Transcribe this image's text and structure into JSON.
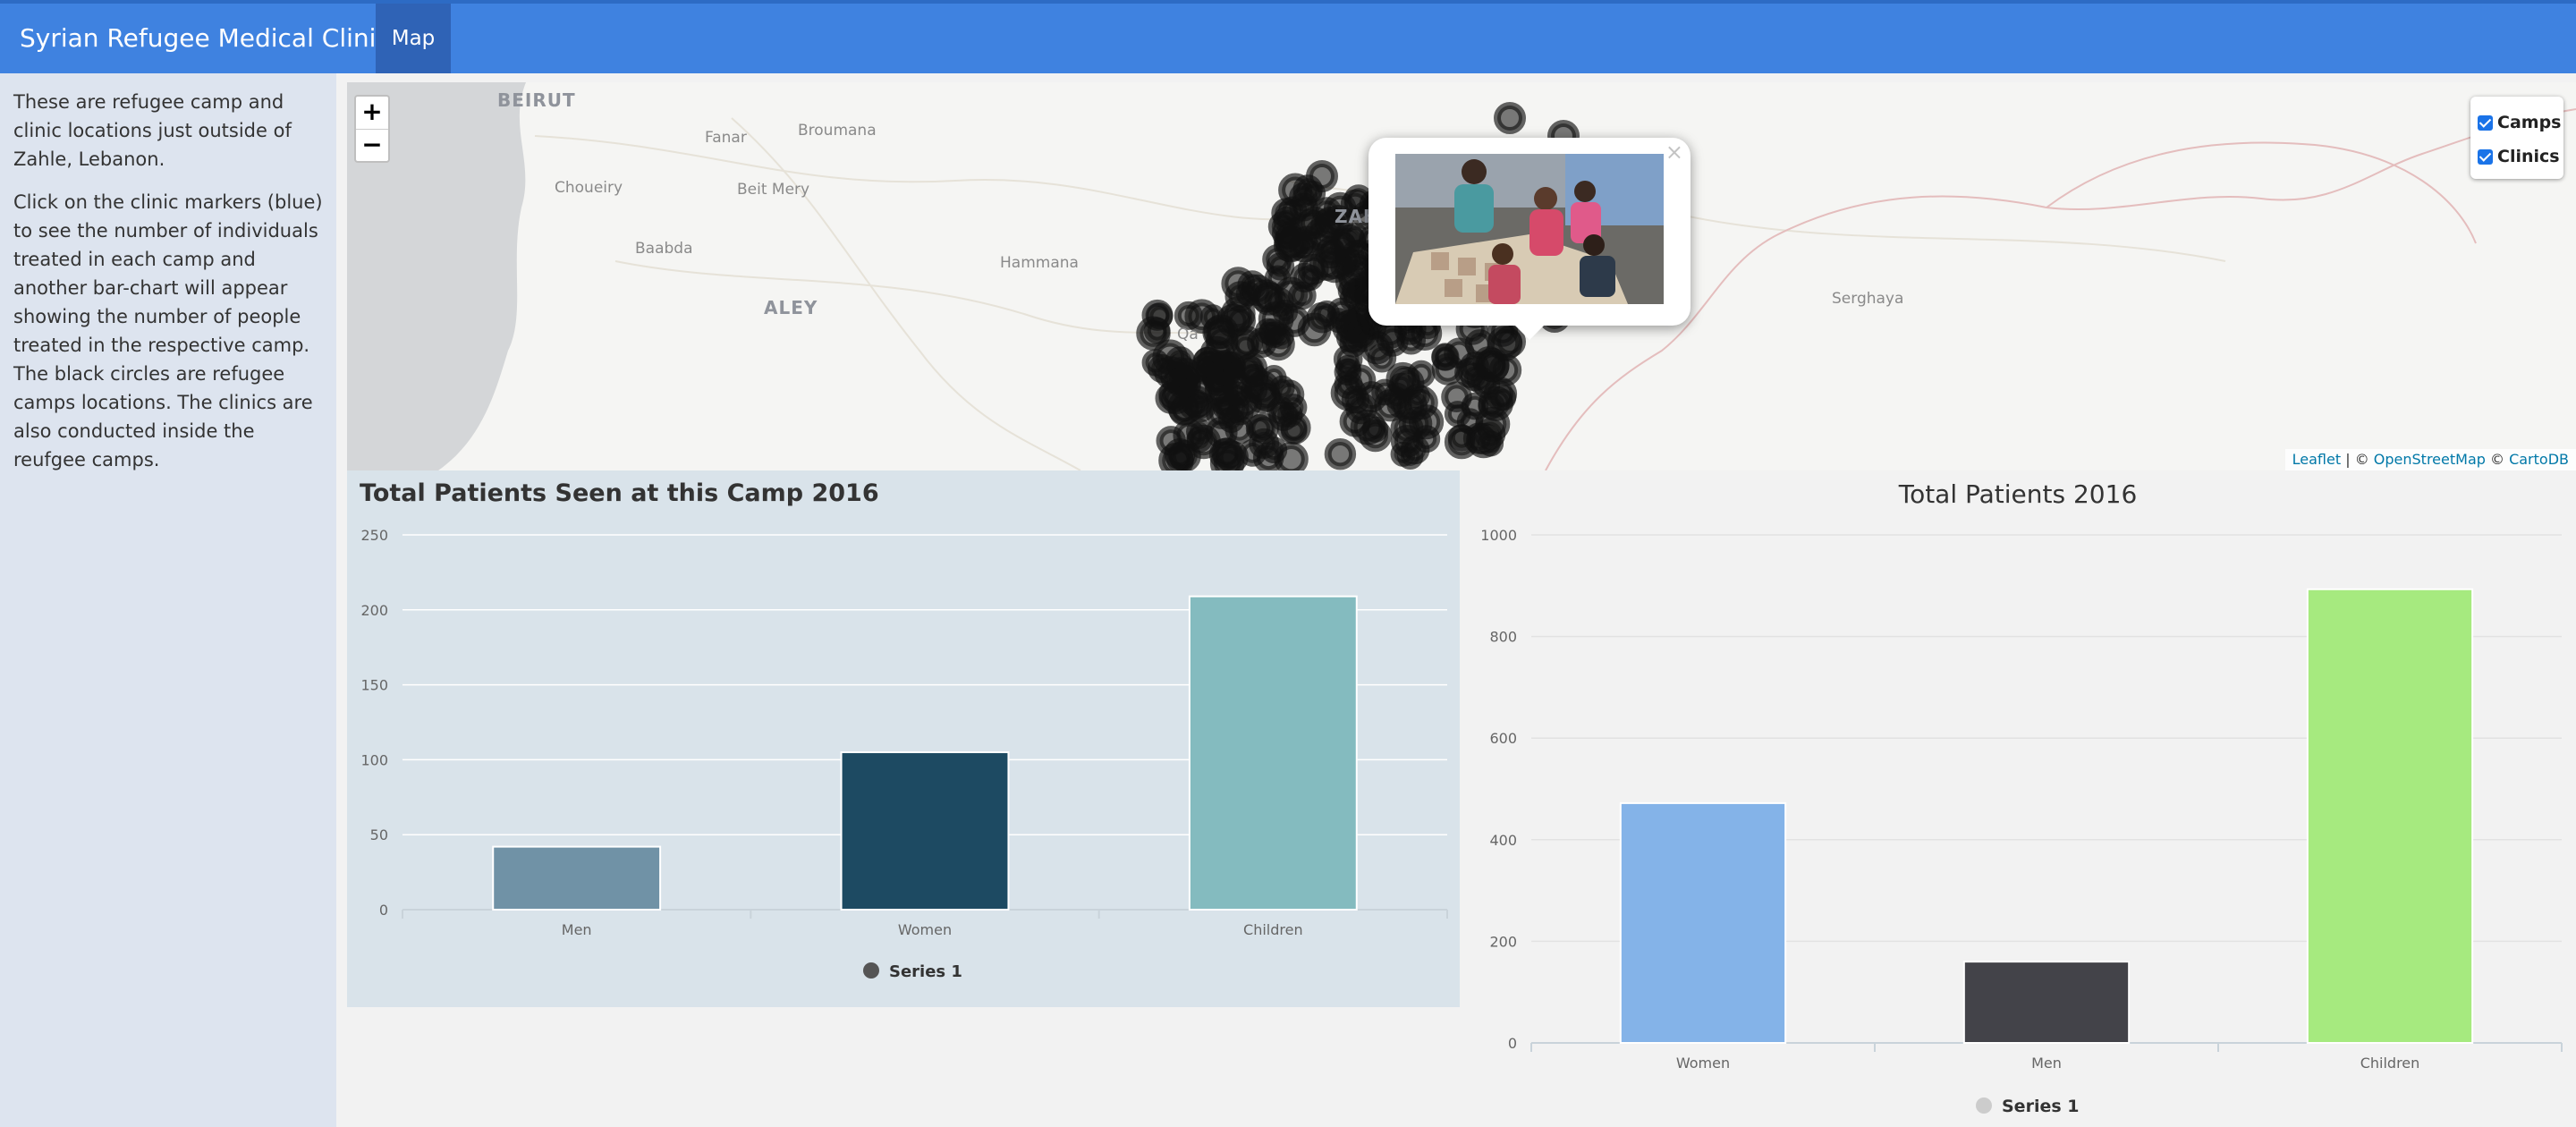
{
  "navbar": {
    "brand": "Syrian Refugee Medical Clinics",
    "tab_label": "Map"
  },
  "sidebar": {
    "paragraph_1": "These are refugee camp and clinic locations just outside of Zahle, Lebanon.",
    "paragraph_2": "Click on the clinic markers (blue) to see the number of individuals treated in each camp and another bar-chart will appear showing the number of people treated in the respective camp. The black circles are refugee camps locations. The clinics are also conducted inside the reufgee camps."
  },
  "map": {
    "zoom_in": "+",
    "zoom_out": "−",
    "layers": [
      {
        "label": "Camps",
        "checked": true
      },
      {
        "label": "Clinics",
        "checked": true
      }
    ],
    "place_labels": [
      "BEIRUT",
      "Fanar",
      "Broumana",
      "Choueiry",
      "Beit Mery",
      "Baabda",
      "Hammana",
      "ALEY",
      "ZAH",
      "Qa",
      "Serghaya"
    ],
    "attribution": {
      "leaflet": "Leaflet",
      "sep1": " | © ",
      "osm": "OpenStreetMap",
      "sep2": " © ",
      "carto": "CartoDB"
    },
    "popup_close": "×",
    "colors": {
      "water": "#d4d6d8",
      "land": "#f5f5f3",
      "camps": "#111111",
      "clinic_marker": "#3f8fd6"
    }
  },
  "chart_data": [
    {
      "type": "bar",
      "title": "Total Patients Seen at this Camp 2016",
      "categories": [
        "Men",
        "Women",
        "Children"
      ],
      "values": [
        42,
        105,
        209
      ],
      "colors": [
        "#7092a6",
        "#1d4a62",
        "#84bbbf"
      ],
      "ylim": [
        0,
        250
      ],
      "yticks": [
        "0",
        "50",
        "100",
        "150",
        "200",
        "250"
      ],
      "series": [
        {
          "name": "Series 1",
          "values": [
            42,
            105,
            209
          ]
        }
      ],
      "legend": "bottom",
      "grid": true
    },
    {
      "type": "bar",
      "title": "Total Patients 2016",
      "categories": [
        "Women",
        "Men",
        "Children"
      ],
      "values": [
        472,
        160,
        893
      ],
      "colors": [
        "#84b3e8",
        "#434349",
        "#a6ea7f"
      ],
      "ylim": [
        0,
        1000
      ],
      "yticks": [
        "0",
        "200",
        "400",
        "600",
        "800",
        "1000"
      ],
      "series": [
        {
          "name": "Series 1",
          "values": [
            472,
            160,
            893
          ]
        }
      ],
      "legend": "bottom",
      "grid": true
    }
  ]
}
